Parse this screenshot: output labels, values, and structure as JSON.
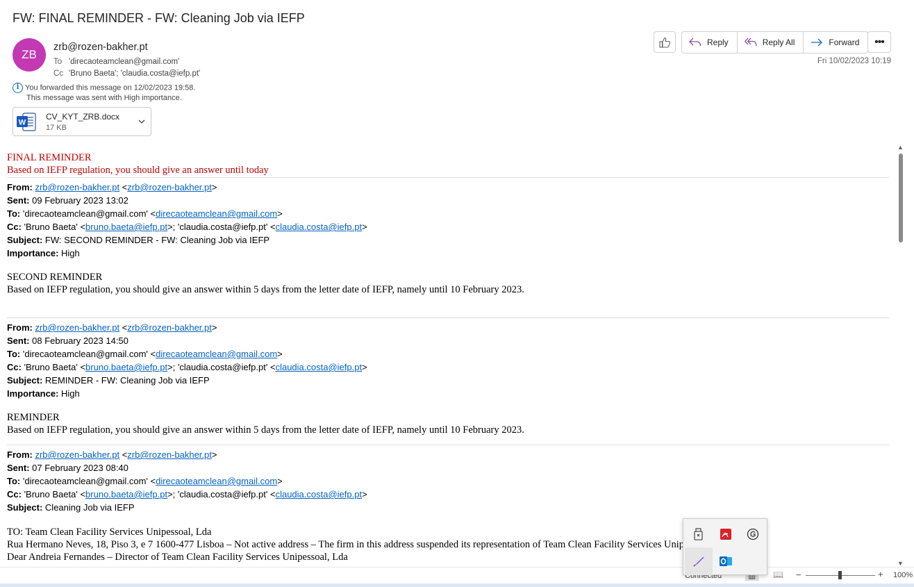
{
  "message": {
    "subject": "FW: FINAL REMINDER - FW: Cleaning Job via IEFP",
    "avatar_initials": "ZB",
    "sender": "zrb@rozen-bakher.pt",
    "to_label": "To",
    "to_value": "'direcaoteamclean@gmail.com'",
    "cc_label": "Cc",
    "cc_value": "'Bruno Baeta'; 'claudia.costa@iefp.pt'",
    "info_forwarded": "You forwarded this message on 12/02/2023 19:58.",
    "info_importance": "This message was sent with High importance.",
    "date": "Fri 10/02/2023 10:19",
    "avatar_color": "#c239b3"
  },
  "attachment": {
    "name": "CV_KYT_ZRB.docx",
    "size": "17 KB",
    "icon": "word-doc-icon"
  },
  "actions": {
    "reply": "Reply",
    "reply_all": "Reply All",
    "forward": "Forward",
    "more": "•••"
  },
  "body": {
    "final_title": "FINAL REMINDER",
    "final_text": "Based on IEFP regulation, you should give an answer until today",
    "blocks": [
      {
        "from_label": "From:",
        "from_link1": "zrb@rozen-bakher.pt",
        "from_link2": "zrb@rozen-bakher.pt",
        "sent_label": "Sent:",
        "sent": "09 February 2023 13:02",
        "to_label": "To:",
        "to_name": "'direcaoteamclean@gmail.com'",
        "to_link": "direcaoteamclean@gmail.com",
        "cc_label": "Cc:",
        "cc_name1": "'Bruno Baeta'",
        "cc_link1": "bruno.baeta@iefp.pt",
        "cc_name2": "'claudia.costa@iefp.pt'",
        "cc_link2": "claudia.costa@iefp.pt",
        "subject_label": "Subject:",
        "subject": "FW: SECOND REMINDER - FW: Cleaning Job via IEFP",
        "importance_label": "Importance:",
        "importance": "High",
        "title": "SECOND REMINDER",
        "text": "Based on IEFP regulation, you should give an answer within 5 days from the letter date of IEFP, namely until 10 February 2023."
      },
      {
        "from_label": "From:",
        "from_link1": "zrb@rozen-bakher.pt",
        "from_link2": "zrb@rozen-bakher.pt",
        "sent_label": "Sent:",
        "sent": "08 February 2023 14:50",
        "to_label": "To:",
        "to_name": "'direcaoteamclean@gmail.com'",
        "to_link": "direcaoteamclean@gmail.com",
        "cc_label": "Cc:",
        "cc_name1": "'Bruno Baeta'",
        "cc_link1": "bruno.baeta@iefp.pt",
        "cc_name2": "'claudia.costa@iefp.pt'",
        "cc_link2": "claudia.costa@iefp.pt",
        "subject_label": "Subject:",
        "subject": "REMINDER - FW: Cleaning Job via IEFP",
        "importance_label": "Importance:",
        "importance": "High",
        "title": "REMINDER",
        "text": "Based on IEFP regulation, you should give an answer within 5 days from the letter date of IEFP, namely until 10 February 2023."
      },
      {
        "from_label": "From:",
        "from_link1": "zrb@rozen-bakher.pt",
        "from_link2": "zrb@rozen-bakher.pt",
        "sent_label": "Sent:",
        "sent": "07 February 2023 08:40",
        "to_label": "To:",
        "to_name": "'direcaoteamclean@gmail.com'",
        "to_link": "direcaoteamclean@gmail.com",
        "cc_label": "Cc:",
        "cc_name1": "'Bruno Baeta'",
        "cc_link1": "bruno.baeta@iefp.pt",
        "cc_name2": "'claudia.costa@iefp.pt'",
        "cc_link2": "claudia.costa@iefp.pt",
        "subject_label": "Subject:",
        "subject": "Cleaning Job via IEFP",
        "line1": "TO: Team Clean Facility Services Unipessoal, Lda",
        "line2": "Rua Hermano Neves, 18, Piso 3, e 7 1600-477 Lisboa – Not active address – The firm in this address suspended its representation of Team Clean Facility Services Unipessoal, Lda",
        "line3": "Dear Andreia Fernandes – Director of Team Clean Facility Services Unipessoal, Lda"
      }
    ]
  },
  "statusbar": {
    "connection": "Connected",
    "zoom_minus": "−",
    "zoom_plus": "+",
    "zoom": "100%"
  },
  "tray_icons": [
    "usb-drive-icon",
    "pdf-reader-icon",
    "grammarly-icon",
    "pen-icon",
    "outlook-icon"
  ]
}
